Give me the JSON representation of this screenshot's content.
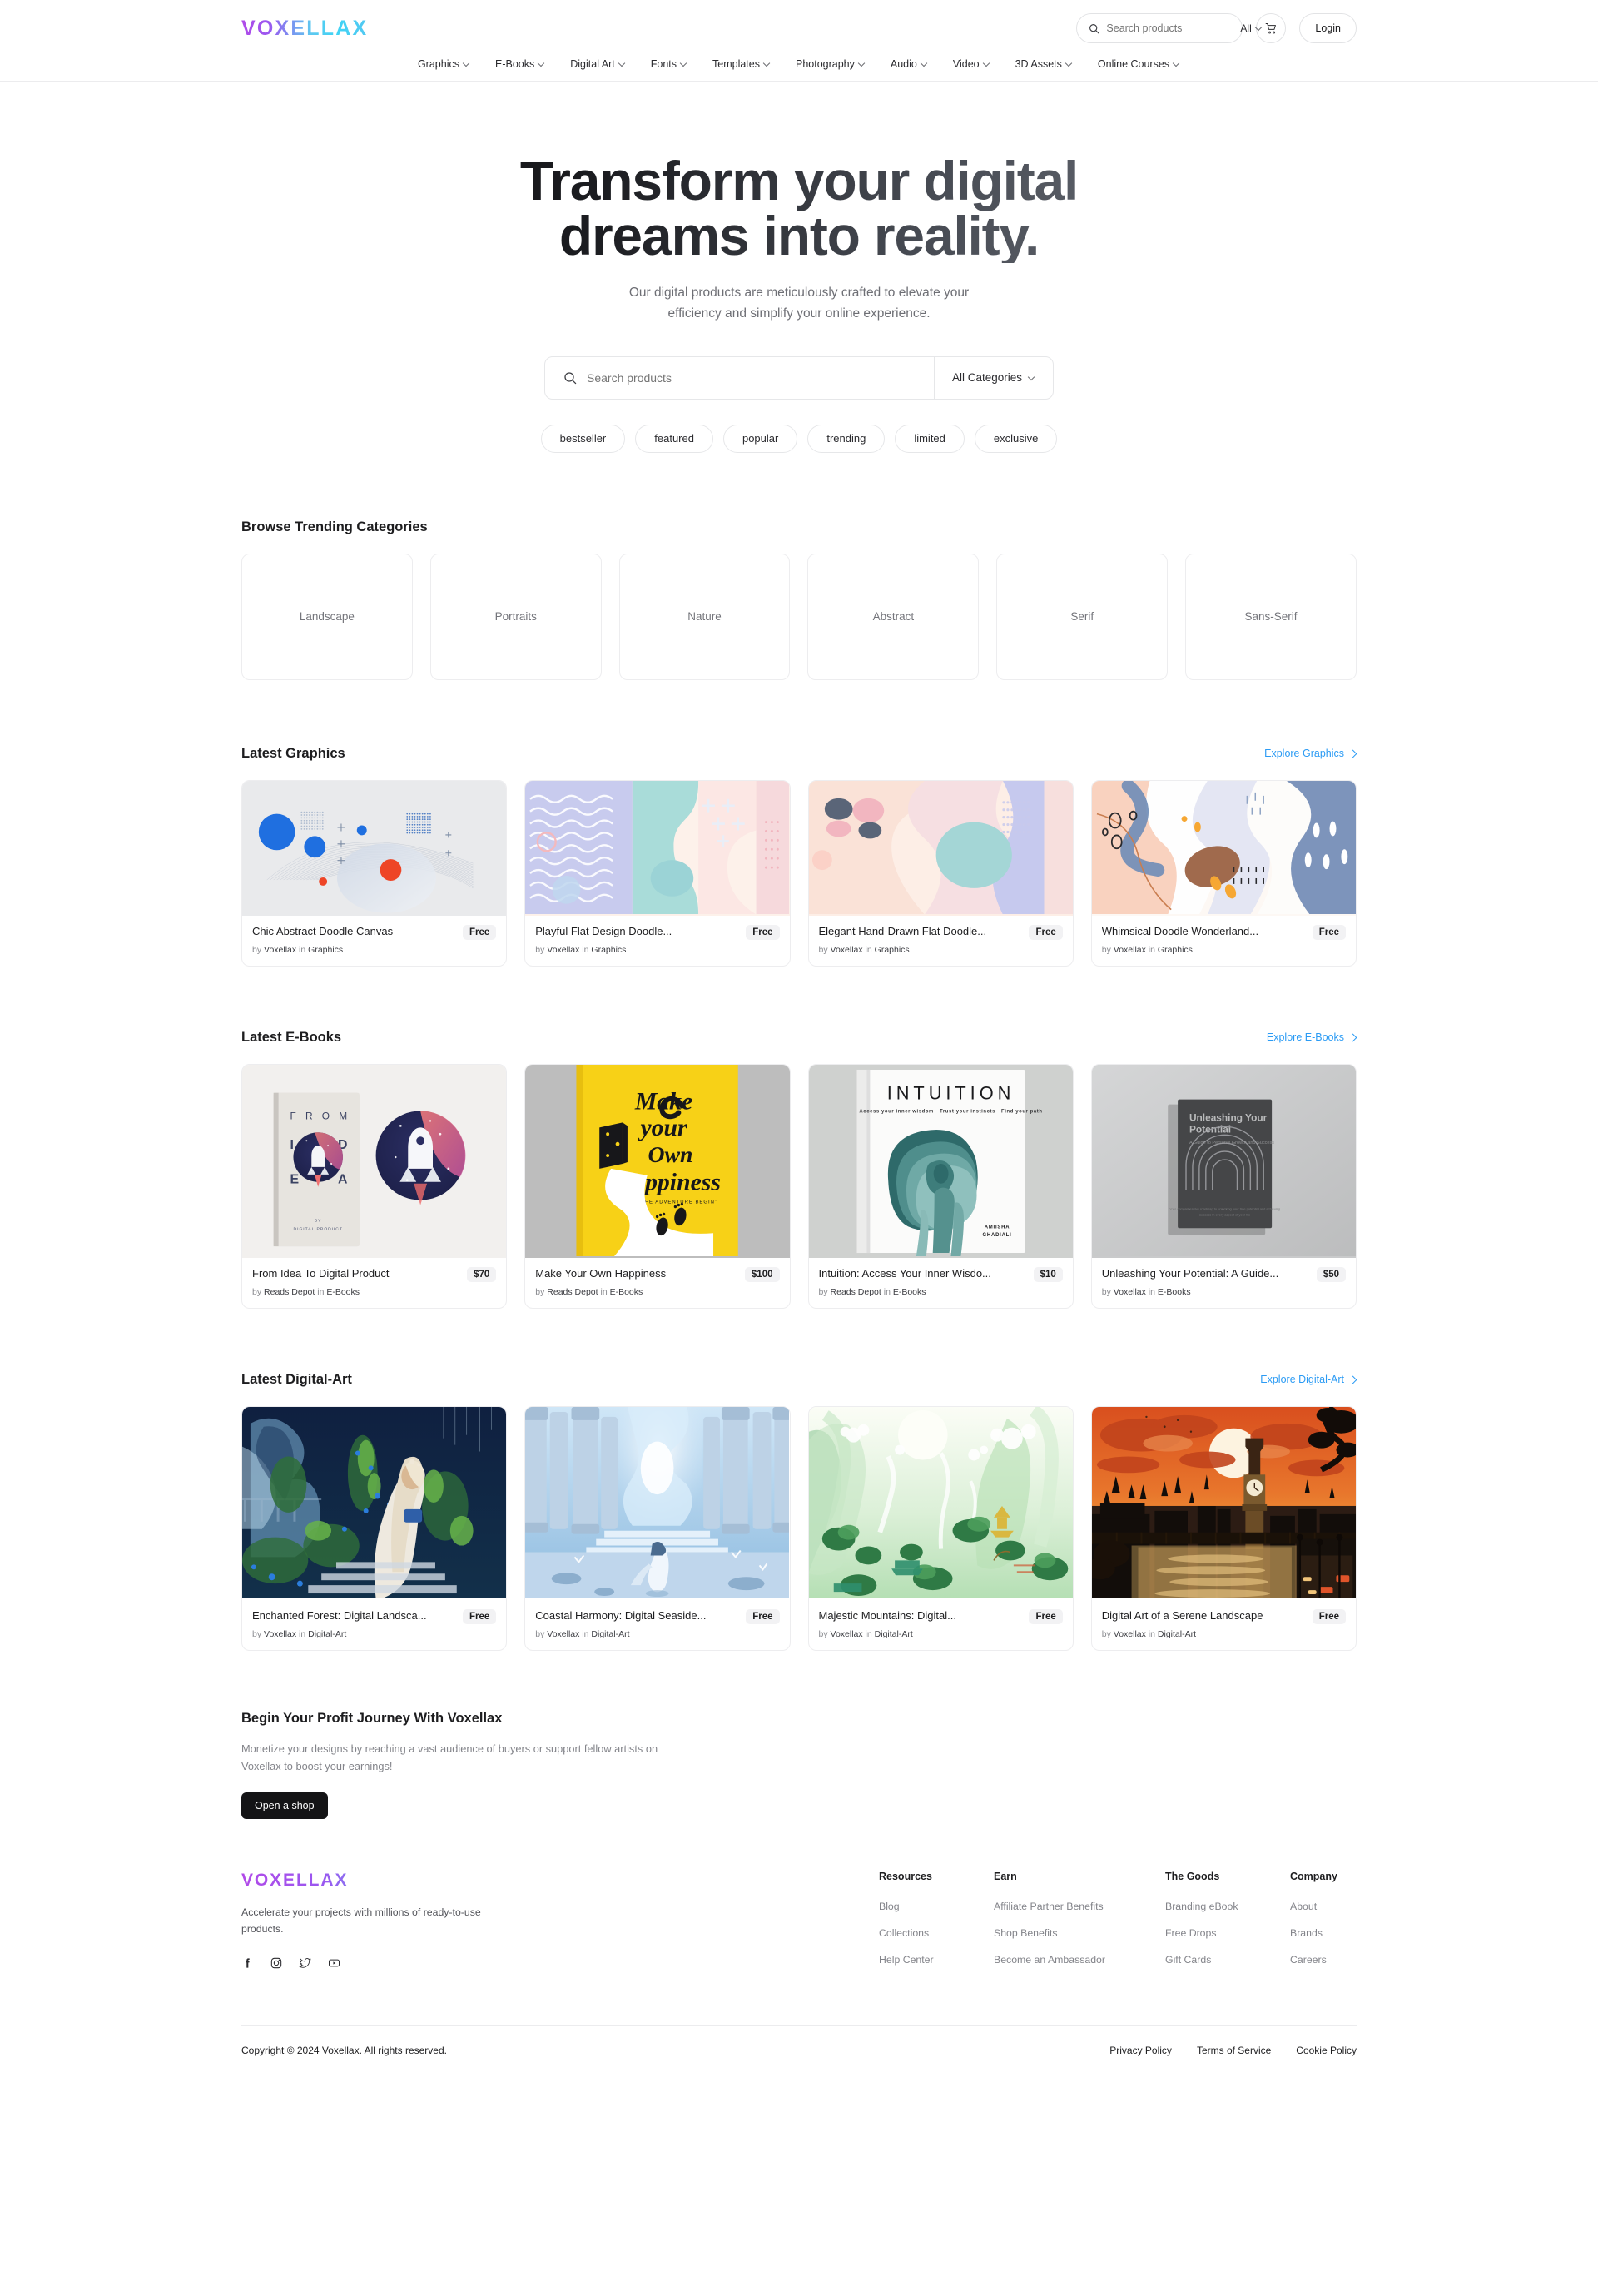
{
  "header": {
    "logo": "VOXELLAX",
    "search": {
      "placeholder": "Search products",
      "value": "",
      "category": "All",
      "icon": "search-icon"
    },
    "cart_icon": "cart-icon",
    "login_label": "Login",
    "nav": [
      {
        "label": "Graphics"
      },
      {
        "label": "E-Books"
      },
      {
        "label": "Digital Art"
      },
      {
        "label": "Fonts"
      },
      {
        "label": "Templates"
      },
      {
        "label": "Photography"
      },
      {
        "label": "Audio"
      },
      {
        "label": "Video"
      },
      {
        "label": "3D Assets"
      },
      {
        "label": "Online Courses"
      }
    ]
  },
  "hero": {
    "title_line1": "Transform your digital",
    "title_line2": "dreams into reality.",
    "subtitle_line1": "Our digital products are meticulously crafted to elevate your",
    "subtitle_line2": "efficiency and simplify your online experience.",
    "search": {
      "placeholder": "Search products",
      "value": "",
      "category": "All Categories"
    },
    "tags": [
      "bestseller",
      "featured",
      "popular",
      "trending",
      "limited",
      "exclusive"
    ]
  },
  "categories_section": {
    "title": "Browse Trending Categories",
    "items": [
      {
        "label": "Landscape"
      },
      {
        "label": "Portraits"
      },
      {
        "label": "Nature"
      },
      {
        "label": "Abstract"
      },
      {
        "label": "Serif"
      },
      {
        "label": "Sans-Serif"
      }
    ]
  },
  "graphics_section": {
    "title": "Latest Graphics",
    "link": "Explore Graphics",
    "products": [
      {
        "name": "Chic Abstract Doodle Canvas",
        "price": "Free",
        "by_prefix": "by",
        "author": "Voxellax",
        "in_prefix": "in",
        "category": "Graphics"
      },
      {
        "name": "Playful Flat Design Doodle...",
        "price": "Free",
        "by_prefix": "by",
        "author": "Voxellax",
        "in_prefix": "in",
        "category": "Graphics"
      },
      {
        "name": "Elegant Hand-Drawn Flat Doodle...",
        "price": "Free",
        "by_prefix": "by",
        "author": "Voxellax",
        "in_prefix": "in",
        "category": "Graphics"
      },
      {
        "name": "Whimsical Doodle Wonderland...",
        "price": "Free",
        "by_prefix": "by",
        "author": "Voxellax",
        "in_prefix": "in",
        "category": "Graphics"
      }
    ]
  },
  "ebooks_section": {
    "title": "Latest E-Books",
    "link": "Explore E-Books",
    "products": [
      {
        "name": "From Idea To Digital Product",
        "price": "$70",
        "by_prefix": "by",
        "author": "Reads Depot",
        "in_prefix": "in",
        "category": "E-Books",
        "cover_text": "FROM IDEA"
      },
      {
        "name": "Make Your Own Happiness",
        "price": "$100",
        "by_prefix": "by",
        "author": "Reads Depot",
        "in_prefix": "in",
        "category": "E-Books",
        "cover_text": "Make your Own Happiness"
      },
      {
        "name": "Intuition: Access Your Inner Wisdo...",
        "price": "$10",
        "by_prefix": "by",
        "author": "Reads Depot",
        "in_prefix": "in",
        "category": "E-Books",
        "cover_text": "INTUITION",
        "cover_sub": "Access your inner wisdom · Trust your instincts · Find your path"
      },
      {
        "name": "Unleashing Your Potential: A Guide...",
        "price": "$50",
        "by_prefix": "by",
        "author": "Voxellax",
        "in_prefix": "in",
        "category": "E-Books",
        "cover_text": "Unleashing Your Potential",
        "cover_sub": "A Guide to Personal Growth and Success"
      }
    ]
  },
  "digitalart_section": {
    "title": "Latest Digital-Art",
    "link": "Explore Digital-Art",
    "products": [
      {
        "name": "Enchanted Forest: Digital Landsca...",
        "price": "Free",
        "by_prefix": "by",
        "author": "Voxellax",
        "in_prefix": "in",
        "category": "Digital-Art"
      },
      {
        "name": "Coastal Harmony: Digital Seaside...",
        "price": "Free",
        "by_prefix": "by",
        "author": "Voxellax",
        "in_prefix": "in",
        "category": "Digital-Art"
      },
      {
        "name": "Majestic Mountains: Digital...",
        "price": "Free",
        "by_prefix": "by",
        "author": "Voxellax",
        "in_prefix": "in",
        "category": "Digital-Art"
      },
      {
        "name": "Digital Art of a Serene Landscape",
        "price": "Free",
        "by_prefix": "by",
        "author": "Voxellax",
        "in_prefix": "in",
        "category": "Digital-Art"
      }
    ]
  },
  "cta": {
    "title": "Begin Your Profit Journey With Voxellax",
    "body_line1": "Monetize your designs by reaching a vast audience of buyers or support fellow artists on",
    "body_line2": "Voxellax to boost your earnings!",
    "button": "Open a shop"
  },
  "footer": {
    "logo": "VOXELLAX",
    "description": "Accelerate your projects with millions of ready-to-use products.",
    "social": [
      {
        "name": "facebook-icon"
      },
      {
        "name": "instagram-icon"
      },
      {
        "name": "twitter-icon"
      },
      {
        "name": "youtube-icon"
      }
    ],
    "columns": [
      {
        "heading": "Resources",
        "links": [
          "Blog",
          "Collections",
          "Help Center"
        ]
      },
      {
        "heading": "Earn",
        "links": [
          "Affiliate Partner Benefits",
          "Shop Benefits",
          "Become an Ambassador"
        ]
      },
      {
        "heading": "The Goods",
        "links": [
          "Branding eBook",
          "Free Drops",
          "Gift Cards"
        ]
      },
      {
        "heading": "Company",
        "links": [
          "About",
          "Brands",
          "Careers"
        ]
      }
    ],
    "copyright": "Copyright © 2024 Voxellax. All rights reserved.",
    "legal": [
      "Privacy Policy",
      "Terms of Service",
      "Cookie Policy"
    ]
  },
  "colors": {
    "accent_link": "#2b9bf4",
    "logo_start": "#b14ae8",
    "logo_end": "#3fd4f5",
    "cta_button_bg": "#141416"
  }
}
